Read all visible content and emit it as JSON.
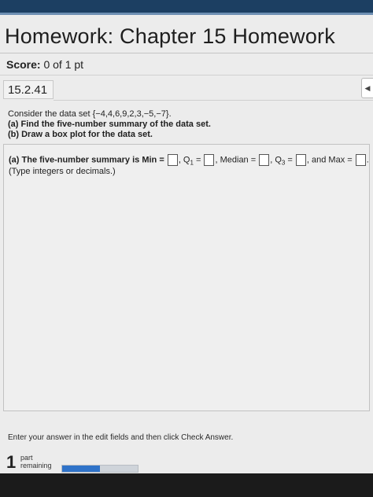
{
  "header": {
    "title": "Homework: Chapter 15 Homework"
  },
  "score": {
    "label": "Score:",
    "value": "0 of 1 pt"
  },
  "question": {
    "number": "15.2.41",
    "line1": "Consider the data set {−4,4,6,9,2,3,−5,−7}.",
    "part_a": "(a) Find the five-number summary of the data set.",
    "part_b": "(b) Draw a box plot for the data set."
  },
  "answer": {
    "prefix": "(a) The five-number summary is Min =",
    "q1_label": ", Q",
    "q1_sub": "1",
    "q1_eq": " =",
    "median_label": ", Median =",
    "q3_label": ", Q",
    "q3_sub": "3",
    "q3_eq": " =",
    "max_label": ", and Max =",
    "end": ".",
    "type_note": "(Type integers or decimals.)"
  },
  "footer": {
    "instruction": "Enter your answer in the edit fields and then click Check Answer.",
    "remaining_count": "1",
    "remaining_line1": "part",
    "remaining_line2": "remaining",
    "progress_fraction": 0.5
  },
  "side_tab_icon": "chevron-left-icon"
}
